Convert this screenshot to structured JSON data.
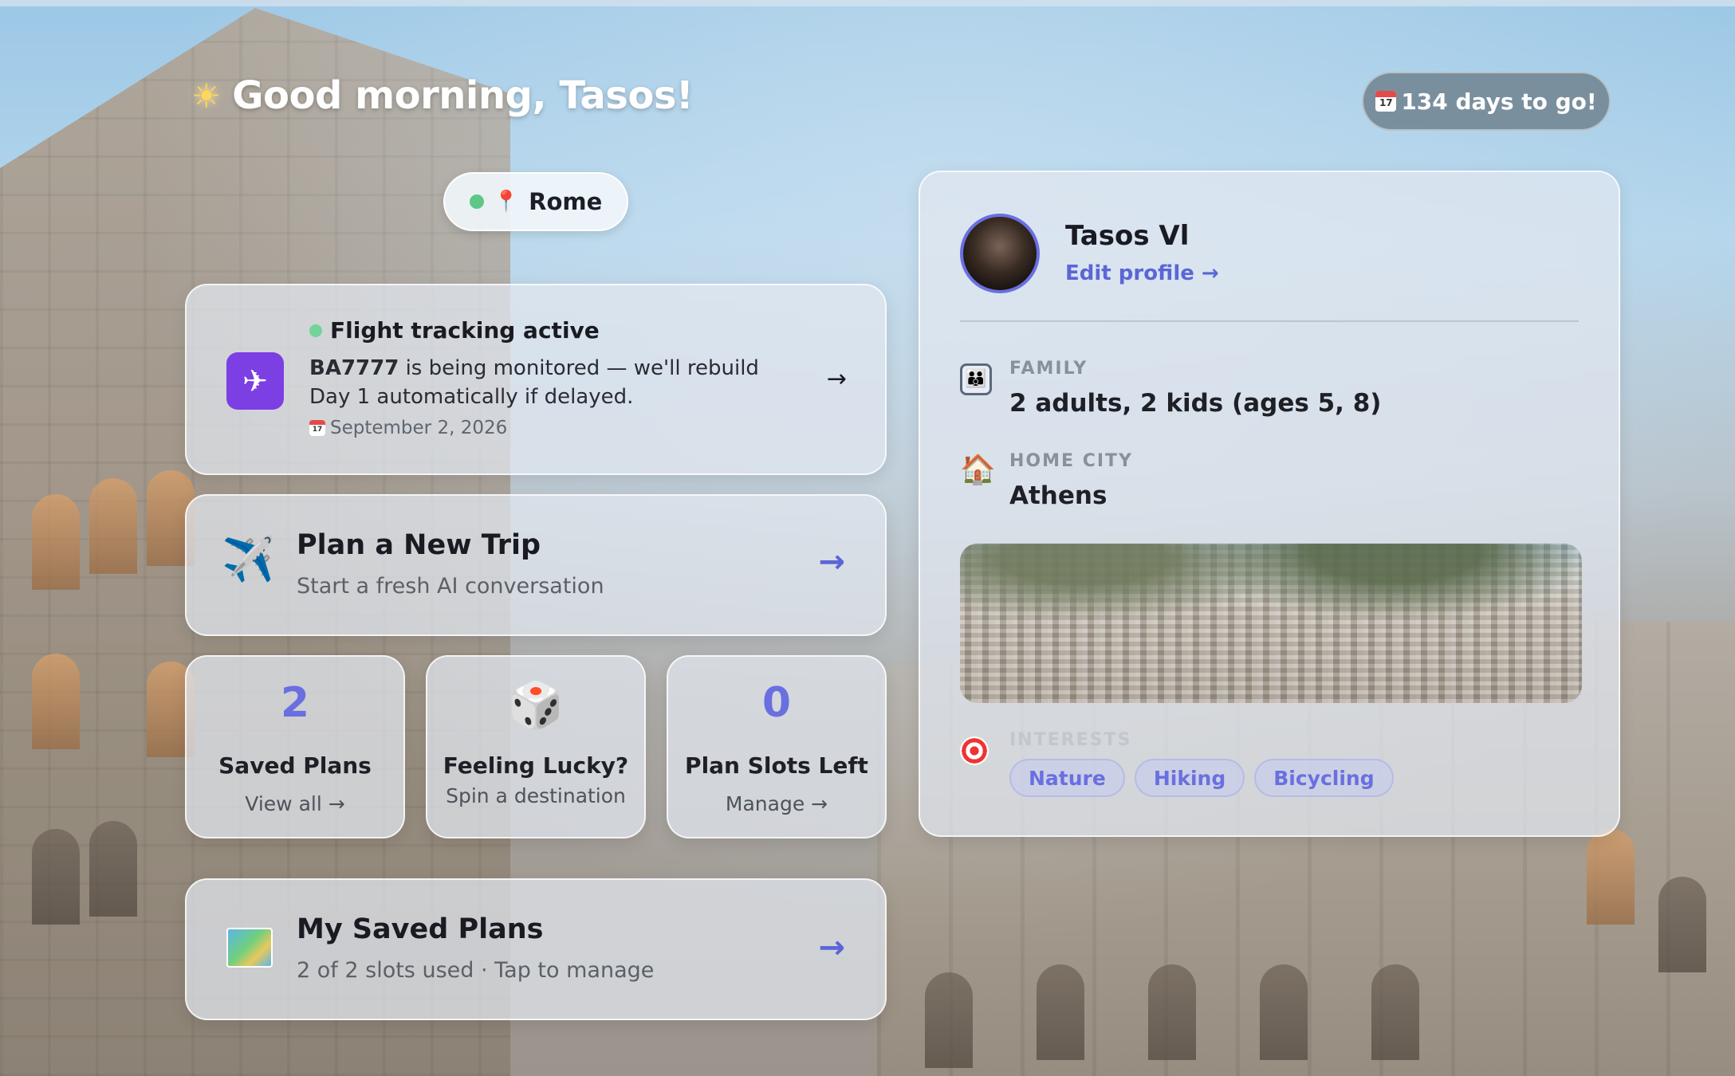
{
  "header": {
    "greeting": "Good morning, Tasos!",
    "greeting_icon": "sun-icon",
    "countdown": "134 days to go!",
    "countdown_icon": "calendar-icon",
    "calendar_day": "17"
  },
  "location": {
    "label": "Rome",
    "status_color": "#5dc788",
    "icon": "pin-icon"
  },
  "flight": {
    "status": "Flight tracking active",
    "flight_number": "BA7777",
    "message": " is being monitored — we'll rebuild Day 1 automatically if delayed.",
    "date": "September 2, 2026",
    "arrow": "→",
    "icon": "plane-icon",
    "accent": "#7b3fe4"
  },
  "plan_new": {
    "icon": "airplane-icon",
    "title": "Plan a New Trip",
    "subtitle": "Start a fresh AI conversation",
    "arrow": "→"
  },
  "tiles": {
    "saved_plans": {
      "value": "2",
      "label": "Saved Plans",
      "action": "View all →"
    },
    "feeling_lucky": {
      "icon": "dice-icon",
      "label": "Feeling Lucky?",
      "action": "Spin a destination"
    },
    "slots_left": {
      "value": "0",
      "label": "Plan Slots Left",
      "action": "Manage →"
    }
  },
  "my_saved": {
    "icon": "map-icon",
    "title": "My Saved Plans",
    "subtitle": "2 of 2 slots used · Tap to manage",
    "arrow": "→"
  },
  "profile": {
    "name": "Tasos Vl",
    "edit_link": "Edit profile →",
    "family_label": "FAMILY",
    "family_value": "2 adults, 2 kids (ages 5, 8)",
    "home_label": "HOME CITY",
    "home_value": "Athens",
    "interests_label": "INTERESTS",
    "interests": [
      "Nature",
      "Hiking",
      "Bicycling"
    ]
  },
  "colors": {
    "accent": "#5b66d6",
    "number_accent": "#6a6fe0"
  }
}
